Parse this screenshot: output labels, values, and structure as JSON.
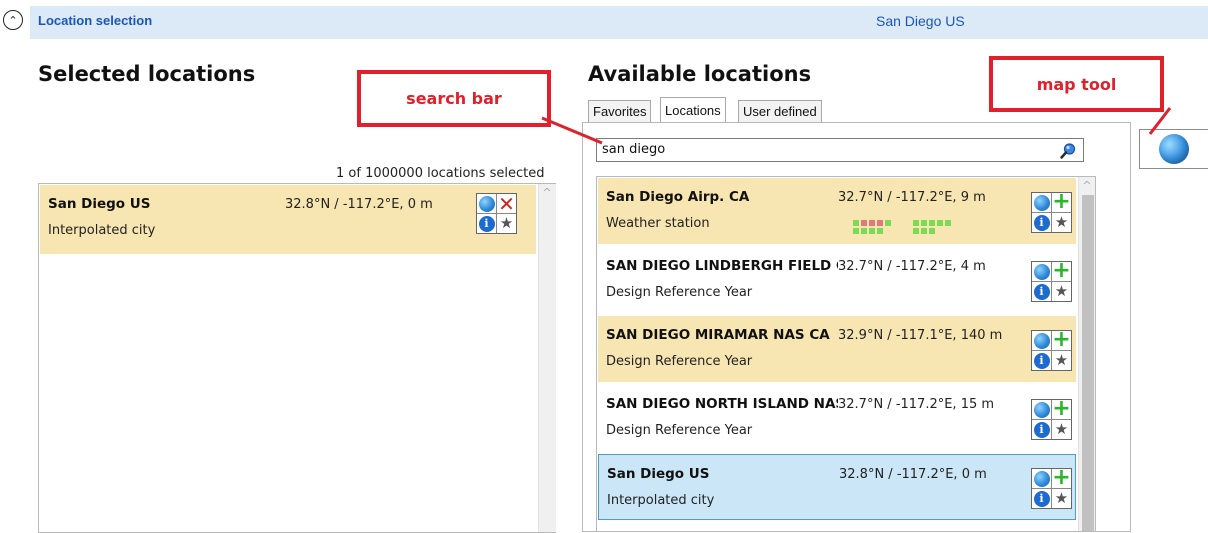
{
  "header": {
    "collapse_glyph": "⌃",
    "title": "Location selection",
    "value": "San Diego US"
  },
  "selected": {
    "title": "Selected locations",
    "count_label": "1 of 1000000 locations selected",
    "items": [
      {
        "name": "San Diego US",
        "coords": "32.8°N / -117.2°E, 0 m",
        "type": "Interpolated city"
      }
    ]
  },
  "available": {
    "title": "Available locations",
    "tabs": [
      {
        "label": "Favorites",
        "active": false
      },
      {
        "label": "Locations",
        "active": true
      },
      {
        "label": "User defined",
        "active": false
      }
    ],
    "search": {
      "value": "san diego",
      "placeholder": ""
    },
    "items": [
      {
        "name": "San Diego Airp. CA",
        "coords": "32.7°N / -117.2°E, 9 m",
        "type": "Weather station",
        "state": "yellow"
      },
      {
        "name": "SAN DIEGO LINDBERGH FIELD CA",
        "coords": "32.7°N / -117.2°E, 4 m",
        "type": "Design Reference Year",
        "state": "white"
      },
      {
        "name": "SAN DIEGO MIRAMAR NAS CA",
        "coords": "32.9°N / -117.1°E, 140 m",
        "type": "Design Reference Year",
        "state": "yellow"
      },
      {
        "name": "SAN DIEGO NORTH ISLAND NAS CA",
        "coords": "32.7°N / -117.2°E, 15 m",
        "type": "Design Reference Year",
        "state": "white"
      },
      {
        "name": "San Diego US",
        "coords": "32.8°N / -117.2°E, 0 m",
        "type": "Interpolated city",
        "state": "selected"
      }
    ]
  },
  "callouts": {
    "search_bar": "search bar",
    "map_tool": "map tool"
  },
  "icons": {
    "globe": "globe-icon",
    "remove": "remove-icon",
    "add": "add-icon",
    "info": "info-icon",
    "favorite": "star-icon",
    "search": "magnifier-icon",
    "map": "map-globe-icon"
  },
  "icon_glyphs": {
    "info": "i",
    "star": "★",
    "plus": "+",
    "cross": "✕",
    "scroll_up": "^"
  },
  "colors": {
    "accent": "#1a56b8",
    "header_bg": "#dceaf7",
    "row_yellow": "#f8e6b2",
    "row_selected": "#cbe6f6",
    "callout_red": "#e0212c"
  }
}
